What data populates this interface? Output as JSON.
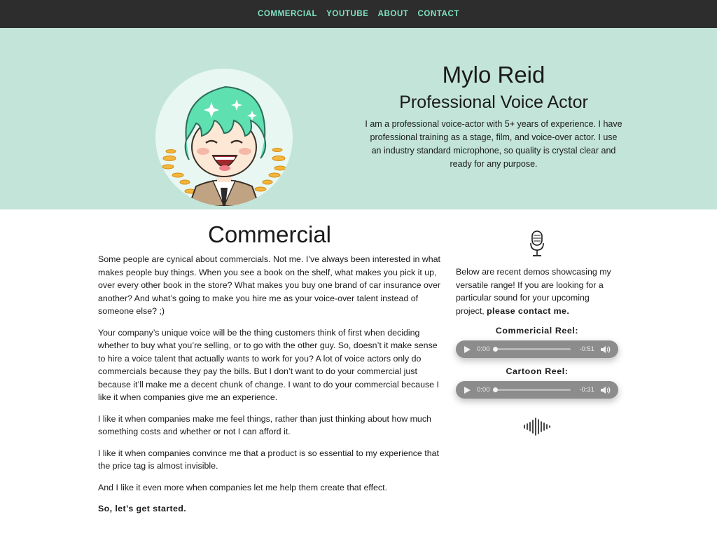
{
  "nav": {
    "items": [
      "COMMERCIAL",
      "YOUTUBE",
      "ABOUT",
      "CONTACT"
    ]
  },
  "hero": {
    "name": "Mylo Reid",
    "subtitle": "Professional Voice Actor",
    "bio": "I am a professional voice-actor with 5+ years of experience. I have professional training as a stage, film, and voice-over actor. I use an industry standard microphone, so quality is crystal clear and ready for any purpose."
  },
  "main": {
    "title": "Commercial",
    "paragraphs": [
      "Some people are cynical about commercials. Not me. I’ve always been interested in what makes people buy things. When you see a book on the shelf, what makes you pick it up, over every other book in the store? What makes you buy one brand of car insurance over another? And what’s going to make you hire me as your voice-over talent instead of someone else? ;)",
      "Your company’s unique voice will be the thing customers think of first when deciding whether to buy what you’re selling, or to go with the other guy. So, doesn’t it make sense to hire a voice talent that actually wants to work for you? A lot of voice actors only do commercials because they pay the bills. But I don’t want to do your commercial just because it’ll make me a decent chunk of change. I want to do your commercial because I like it when companies give me an experience.",
      "I like it when companies make me feel things, rather than just thinking about how much something costs and whether or not I can afford it.",
      "I like it when companies convince me that a product is so essential to my experience that the price tag is almost invisible.",
      "And I like it even more when companies let me help them create that effect."
    ],
    "closing": "So, let’s get started."
  },
  "sidebar": {
    "intro": "Below are recent demos showcasing my versatile range! If you are looking for a particular sound for your upcoming project,",
    "contact_link": "please contact me.",
    "reels": [
      {
        "label": "Commericial Reel:",
        "current": "0:00",
        "remaining": "-0:51"
      },
      {
        "label": "Cartoon Reel:",
        "current": "0:00",
        "remaining": "-0:31"
      }
    ]
  },
  "colors": {
    "nav_bg": "#2d2d2d",
    "nav_link": "#7fe3c4",
    "hero_bg": "#c3e4d8",
    "player_bg": "#8c8c8c"
  },
  "icons": {
    "sidebar_top": "microphone-icon",
    "sidebar_bottom": "sound-wave-icon",
    "player_play": "play-icon",
    "player_volume": "volume-icon"
  }
}
